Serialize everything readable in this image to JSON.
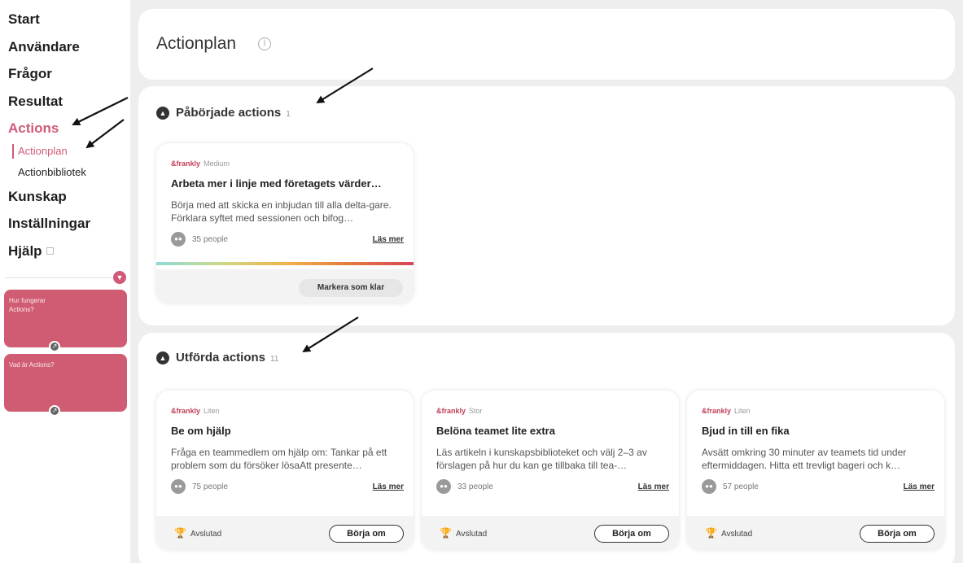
{
  "sidebar": {
    "nav": [
      {
        "label": "Start"
      },
      {
        "label": "Användare"
      },
      {
        "label": "Frågor"
      },
      {
        "label": "Resultat"
      },
      {
        "label": "Actions"
      },
      {
        "label": "Kunskap"
      },
      {
        "label": "Inställningar"
      },
      {
        "label": "Hjälp"
      }
    ],
    "sub": [
      {
        "label": "Actionplan"
      },
      {
        "label": "Actionbibliotek"
      }
    ],
    "help_cards": [
      {
        "label": "Hur fungerar Actions?"
      },
      {
        "label": "Vad är Actions?"
      }
    ]
  },
  "header": {
    "title": "Actionplan",
    "info_icon": "i"
  },
  "started": {
    "title": "Påbörjade actions",
    "count": "1",
    "cards": [
      {
        "brand": "&frankly",
        "size": "Medium",
        "title": "Arbeta mer i linje med företagets värder…",
        "desc": "Börja med att skicka en inbjudan till alla delta-gare. Förklara syftet med sessionen och bifog…",
        "people": "35 people",
        "more": "Läs mer",
        "action": "Markera som klar"
      }
    ]
  },
  "done": {
    "title": "Utförda actions",
    "count": "11",
    "cards": [
      {
        "brand": "&frankly",
        "size": "Liten",
        "title": "Be om hjälp",
        "desc": "Fråga en teammedlem om hjälp om: Tankar på ett problem som du försöker lösaAtt presente…",
        "people": "75 people",
        "more": "Läs mer",
        "status": "Avslutad",
        "action": "Börja om"
      },
      {
        "brand": "&frankly",
        "size": "Stor",
        "title": "Belöna teamet lite extra",
        "desc": "Läs artikeln i kunskapsbiblioteket och välj 2–3 av förslagen på hur du kan ge tillbaka till tea-…",
        "people": "33 people",
        "more": "Läs mer",
        "status": "Avslutad",
        "action": "Börja om"
      },
      {
        "brand": "&frankly",
        "size": "Liten",
        "title": "Bjud in till en fika",
        "desc": "Avsätt omkring 30 minuter av teamets tid under eftermiddagen. Hitta ett trevligt bageri och k…",
        "people": "57 people",
        "more": "Läs mer",
        "status": "Avslutad",
        "action": "Börja om"
      }
    ]
  },
  "colors": {
    "accent": "#d05a78",
    "help_card": "#cf5c72",
    "background": "#eeeeee"
  },
  "icons": [
    "info-icon",
    "chevron-up-icon",
    "people-icon",
    "trophy-icon",
    "external-link-icon",
    "chevron-down-icon",
    "open-icon",
    "annotation-arrow"
  ]
}
